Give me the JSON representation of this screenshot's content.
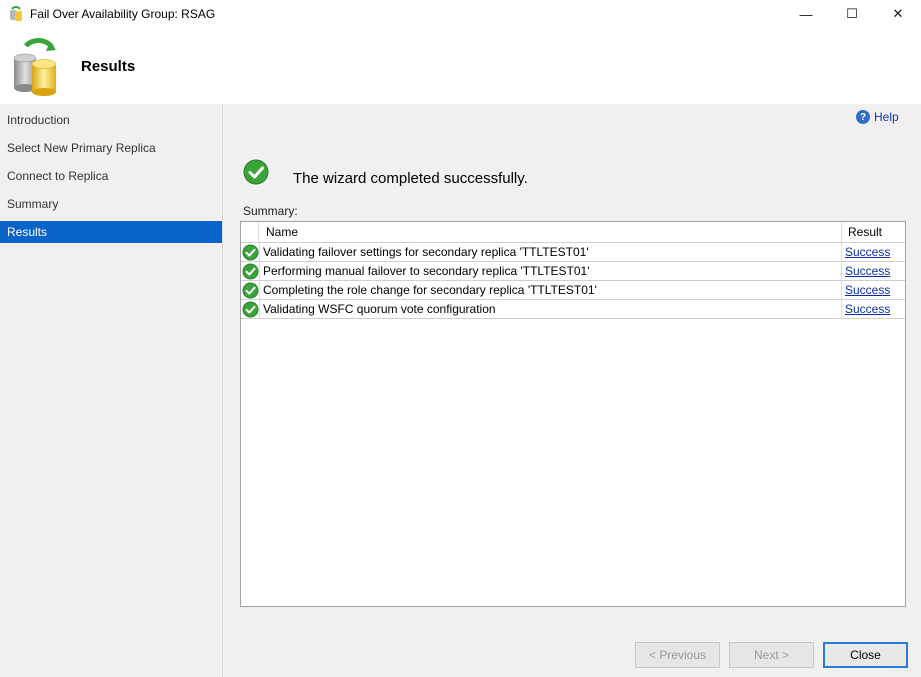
{
  "window": {
    "title": "Fail Over Availability Group: RSAG",
    "minimize_glyph": "—",
    "maximize_glyph": "☐",
    "close_glyph": "✕"
  },
  "header": {
    "page_title": "Results",
    "icon": "database-failover-icon"
  },
  "sidebar": {
    "items": [
      {
        "label": "Introduction",
        "active": false
      },
      {
        "label": "Select New Primary Replica",
        "active": false
      },
      {
        "label": "Connect to Replica",
        "active": false
      },
      {
        "label": "Summary",
        "active": false
      },
      {
        "label": "Results",
        "active": true
      }
    ]
  },
  "main": {
    "help_label": "Help",
    "success_message": "The wizard completed successfully.",
    "summary_label": "Summary:",
    "table": {
      "columns": [
        "Name",
        "Result"
      ],
      "rows": [
        {
          "name": "Validating failover settings for secondary replica 'TTLTEST01'",
          "result": "Success",
          "status_icon": "success-check-icon"
        },
        {
          "name": "Performing manual failover to secondary replica 'TTLTEST01'",
          "result": "Success",
          "status_icon": "success-check-icon"
        },
        {
          "name": "Completing the role change for secondary replica 'TTLTEST01'",
          "result": "Success",
          "status_icon": "success-check-icon"
        },
        {
          "name": "Validating WSFC quorum vote configuration",
          "result": "Success",
          "status_icon": "success-check-icon"
        }
      ]
    }
  },
  "footer": {
    "previous_label": "< Previous",
    "next_label": "Next >",
    "close_label": "Close"
  },
  "colors": {
    "accent": "#0a64c8",
    "success_green": "#3aa33a",
    "link": "#0b2fa8"
  }
}
